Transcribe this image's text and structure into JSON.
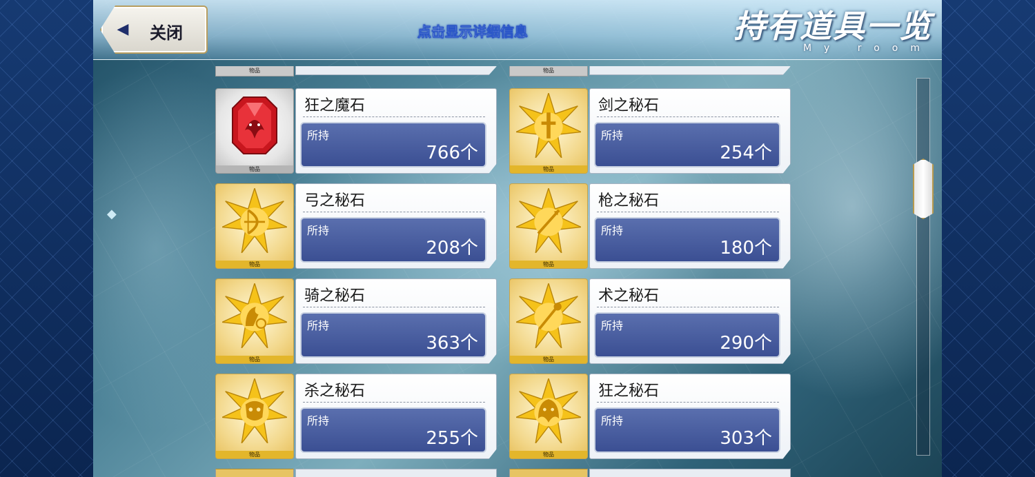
{
  "header": {
    "close_label": "关闭",
    "hint": "点击显示详细信息",
    "title": "持有道具一览",
    "subtitle": "My room"
  },
  "item_tag": "物品",
  "qty_label": "所持",
  "items": [
    {
      "name": "狂之魔石",
      "qty": "766个",
      "icon": "berserker-gem-icon"
    },
    {
      "name": "剑之秘石",
      "qty": "254个",
      "icon": "saber-secret-stone-icon"
    },
    {
      "name": "弓之秘石",
      "qty": "208个",
      "icon": "archer-secret-stone-icon"
    },
    {
      "name": "枪之秘石",
      "qty": "180个",
      "icon": "lancer-secret-stone-icon"
    },
    {
      "name": "骑之秘石",
      "qty": "363个",
      "icon": "rider-secret-stone-icon"
    },
    {
      "name": "术之秘石",
      "qty": "290个",
      "icon": "caster-secret-stone-icon"
    },
    {
      "name": "杀之秘石",
      "qty": "255个",
      "icon": "assassin-secret-stone-icon"
    },
    {
      "name": "狂之秘石",
      "qty": "303个",
      "icon": "berserker-secret-stone-icon"
    }
  ],
  "colors": {
    "gold_frame": "#c7a44a",
    "qty_box": "#3b4f93",
    "gem_red": "#c8161e",
    "border_blue": "#0d2a5a"
  },
  "scroll_position": 0.22
}
